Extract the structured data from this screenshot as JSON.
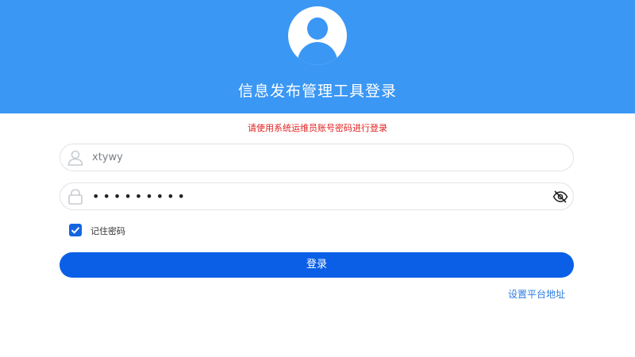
{
  "header": {
    "title": "信息发布管理工具登录"
  },
  "hint": "请使用系统运维员账号密码进行登录",
  "form": {
    "username_value": "xtywy",
    "password_value": "•••••••••",
    "remember_label": "记住密码",
    "remember_checked": true
  },
  "login_button_label": "登录",
  "platform_link_label": "设置平台地址",
  "colors": {
    "header_bg": "#3a97f4",
    "primary_button": "#0b5fe6",
    "hint_text": "#e02020",
    "link": "#2b7de0"
  },
  "icons": {
    "avatar": "user-avatar-icon",
    "username": "user-icon",
    "password": "lock-icon",
    "toggle": "eye-slash-icon",
    "checkbox": "checkmark-icon"
  }
}
